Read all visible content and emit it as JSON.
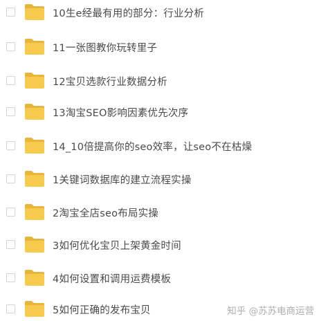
{
  "files": [
    {
      "name": "10生e经最有用的部分：行业分析"
    },
    {
      "name": "11一张图教你玩转里子"
    },
    {
      "name": "12宝贝选款行业数据分析"
    },
    {
      "name": "13淘宝SEO影响因素优先次序"
    },
    {
      "name": "14_10倍提高你的seo效率，让seo不在枯燥"
    },
    {
      "name": "1关键词数据库的建立流程实操"
    },
    {
      "name": "2淘宝全店seo布局实操"
    },
    {
      "name": "3如何优化宝贝上架黄金时间"
    },
    {
      "name": "4如何设置和调用运费模板"
    },
    {
      "name": "5如何正确的发布宝贝"
    }
  ],
  "watermark": "知乎 @苏苏电商运营",
  "colors": {
    "folder_body": "#f7c94d",
    "folder_back": "#e9b43a",
    "text": "#4a4a4a",
    "checkbox_border": "#d4d4d4"
  },
  "icons": {
    "folder": "folder-icon",
    "checkbox": "checkbox"
  }
}
